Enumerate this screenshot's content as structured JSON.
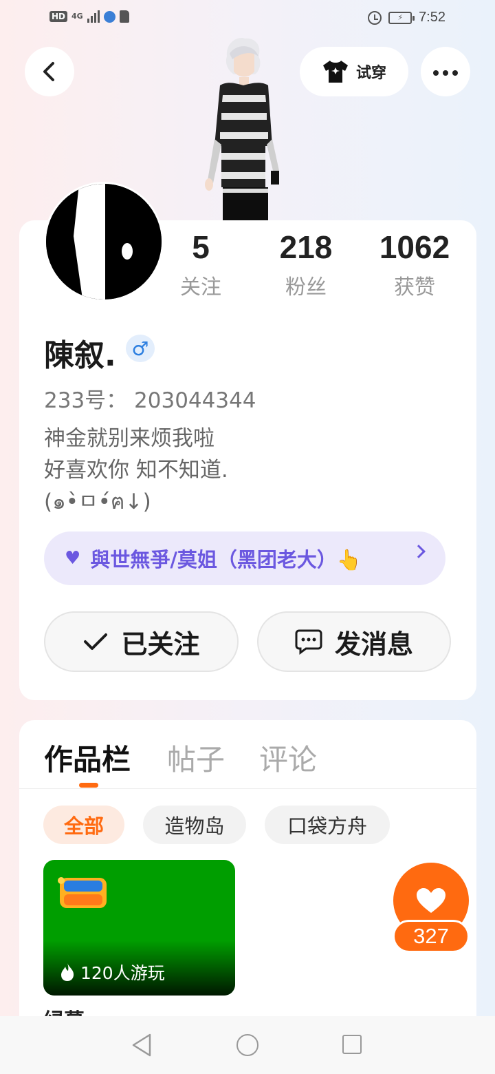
{
  "status_bar": {
    "network": "4G",
    "hd": "HD",
    "time": "7:52"
  },
  "header": {
    "try_on_label": "试穿"
  },
  "profile": {
    "stats": [
      {
        "value": "5",
        "label": "关注"
      },
      {
        "value": "218",
        "label": "粉丝"
      },
      {
        "value": "1062",
        "label": "获赞"
      }
    ],
    "name": "陳叙.",
    "gender_symbol": "♂",
    "uid": "233号： 203044344",
    "bio": "神金就别来烦我啦\n好喜欢你 知不知道.\n(๑•̀ㅁ•́ฅ↓)",
    "guild": "與世無爭/莫姐（黑团老大）👆",
    "follow_label": "已关注",
    "message_label": "发消息"
  },
  "works": {
    "tabs": [
      "作品栏",
      "帖子",
      "评论"
    ],
    "filters": [
      "全部",
      "造物岛",
      "口袋方舟"
    ],
    "game": {
      "plays": "120人游玩",
      "title": "绿幕"
    },
    "likes": "327"
  },
  "colors": {
    "accent": "#ff6a10",
    "guild": "#6b58e0",
    "gender": "#2d7fe0"
  }
}
